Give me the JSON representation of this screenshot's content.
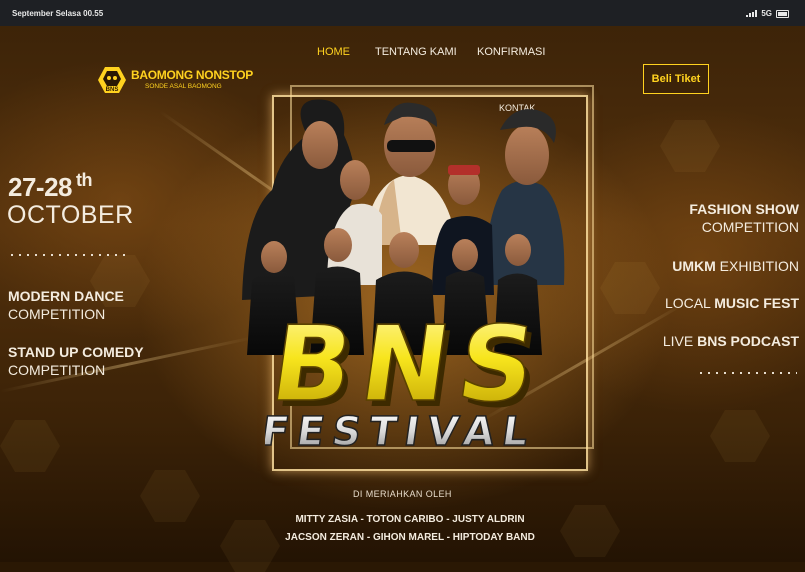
{
  "status_bar": {
    "time": "September Selasa 00.55",
    "network": "5G"
  },
  "nav": {
    "home": "HOME",
    "about": "TENTANG KAMI",
    "confirm": "KONFIRMASI",
    "contact": "KONTAK"
  },
  "logo": {
    "title": "BAOMONG NONSTOP",
    "subtitle": "SONDE ASAL BAOMONG",
    "badge": "BNS"
  },
  "cta": {
    "ticket": "Beli Tiket"
  },
  "event_date": {
    "range": "27-28",
    "suffix": "th",
    "month": "OCTOBER"
  },
  "left_events": [
    {
      "bold": "MODERN DANCE",
      "thin": "COMPETITION"
    },
    {
      "bold": "STAND UP COMEDY",
      "thin": "COMPETITION"
    }
  ],
  "right_events": {
    "fashion": {
      "bold": "FASHION SHOW",
      "thin": "COMPETITION"
    },
    "umkm": {
      "bold": "UMKM",
      "thin": "EXHIBITION"
    },
    "music": {
      "thin": "LOCAL",
      "bold": "MUSIC FEST"
    },
    "podcast": {
      "thin": "LIVE",
      "bold": "BNS PODCAST"
    }
  },
  "poster": {
    "title": "BNS",
    "subtitle": "FESTIVAL"
  },
  "featuring": {
    "label": "DI MERIAHKAN OLEH",
    "line1": "MITTY ZASIA  -  TOTON CARIBO  -  JUSTY ALDRIN",
    "line2": "JACSON ZERAN  -  GIHON MAREL  -  HIPTODAY BAND"
  },
  "colors": {
    "accent": "#ffd21f",
    "text": "#f4ecdf",
    "background": "#3a2208"
  }
}
